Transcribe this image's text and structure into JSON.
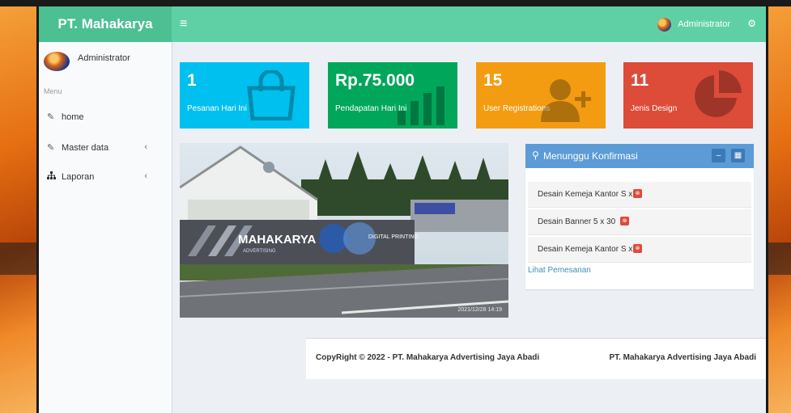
{
  "header": {
    "brand": "PT. Mahakarya",
    "menu_toggle": "≡",
    "user": "Administrator"
  },
  "sidebar": {
    "username": "Administrator",
    "menu_label": "Menu",
    "items": [
      {
        "label": "home",
        "icon": "edit-icon"
      },
      {
        "label": "Master data",
        "icon": "edit-icon",
        "chevron": "‹"
      },
      {
        "label": "Laporan",
        "icon": "sitemap-icon",
        "chevron": "‹"
      }
    ]
  },
  "stats": [
    {
      "value": "1",
      "caption": "Pesanan Hari Ini",
      "color": "#00c0ef",
      "icon": "shopping-bag-icon"
    },
    {
      "value": "Rp.75.000",
      "caption": "Pendapatan Hari Ini",
      "color": "#00a65a",
      "icon": "bar-chart-icon"
    },
    {
      "value": "15",
      "caption": "User Registrations",
      "color": "#f39c12",
      "icon": "user-add-icon"
    },
    {
      "value": "11",
      "caption": "Jenis Design",
      "color": "#dd4b39",
      "icon": "pie-chart-icon"
    }
  ],
  "photo": {
    "timestamp": "2021/12/28 14:19",
    "banner_text": "MAHAKARYA",
    "banner_sub": "ADVERTISING",
    "banner_right": "DIGITAL PRINTING"
  },
  "panel": {
    "title": "Menunggu Konfirmasi",
    "orders": [
      "Desain Kemeja Kantor S x",
      "Desain Banner 5 x 30",
      "Desain Kemeja Kantor S x"
    ],
    "link": "Lihat Pemesanan"
  },
  "footer": {
    "copyright": "CopyRight © 2022 - PT. Mahakarya Advertising Jaya Abadi",
    "company": "PT. Mahakarya Advertising Jaya Abadi"
  }
}
